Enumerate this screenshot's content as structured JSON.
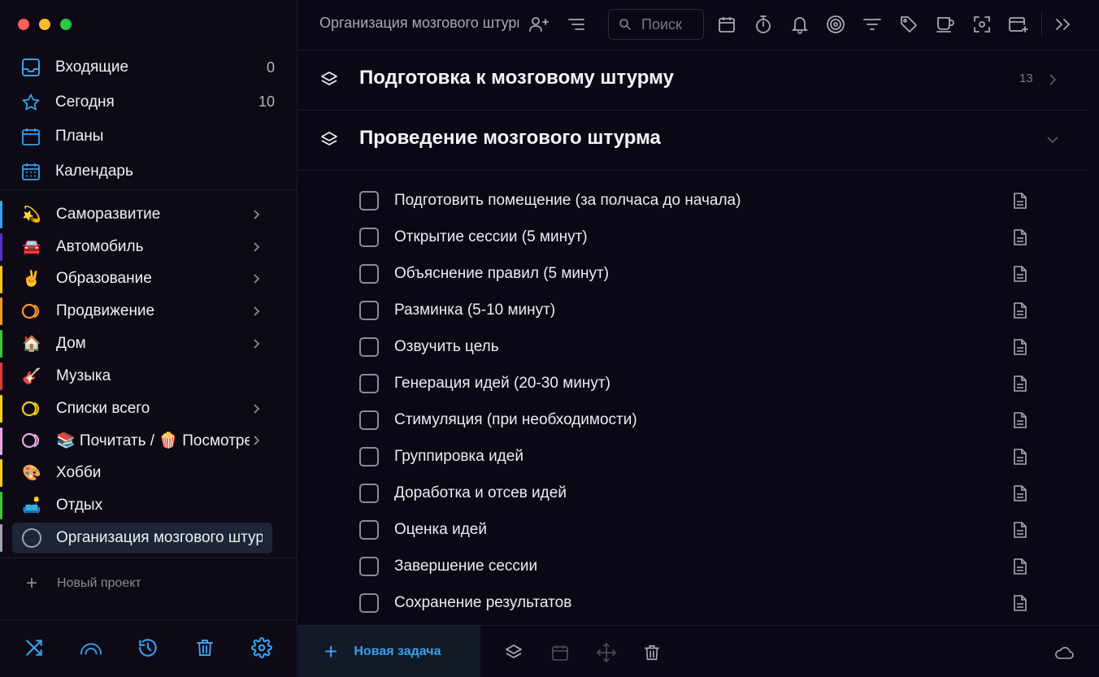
{
  "window": {
    "controls": [
      "close",
      "minimize",
      "maximize"
    ],
    "colors": [
      "#fe5f57",
      "#febc2e",
      "#28c840"
    ]
  },
  "nav": [
    {
      "label": "Входящие",
      "count": "0",
      "icon": "inbox-icon"
    },
    {
      "label": "Сегодня",
      "count": "10",
      "icon": "star-icon"
    },
    {
      "label": "Планы",
      "count": "",
      "icon": "calendar-12-icon",
      "icon_text": "12"
    },
    {
      "label": "Календарь",
      "count": "",
      "icon": "calendar-grid-icon"
    }
  ],
  "projects": [
    {
      "label": "Саморазвитие",
      "emoji": "💫",
      "color": "#3aa0e8",
      "has_children": true
    },
    {
      "label": "Автомобиль",
      "emoji": "🚘",
      "color": "#5b2fc9",
      "has_children": true
    },
    {
      "label": "Образование",
      "emoji": "✌️",
      "color": "#f5c518",
      "has_children": true
    },
    {
      "label": "Продвижение",
      "emoji": "",
      "color": "#f59b23",
      "has_children": true,
      "ring": "#f59b23"
    },
    {
      "label": "Дом",
      "emoji": "🏠",
      "color": "#3ec43a",
      "has_children": true
    },
    {
      "label": "Музыка",
      "emoji": "🎸",
      "color": "#e03a3a",
      "has_children": false
    },
    {
      "label": "Списки всего",
      "emoji": "",
      "color": "#f5d018",
      "has_children": true,
      "ring": "#f5d018"
    },
    {
      "label": "📚 Почитать / 🍿 Посмотреть",
      "emoji": "",
      "color": "#e9a6e6",
      "has_children": true,
      "ring": "#e9a6e6"
    },
    {
      "label": "Хобби",
      "emoji": "🎨",
      "color": "#f5d018",
      "has_children": false
    },
    {
      "label": "Отдых",
      "emoji": "🛋️",
      "color": "#3ec43a",
      "has_children": false
    },
    {
      "label": "Организация мозгового штурма",
      "emoji": "",
      "color": "#a3a3b0",
      "has_children": false,
      "active": true,
      "ring": "#a3a3b0"
    }
  ],
  "new_project_label": "Новый проект",
  "sidebar_bottom_icons": [
    "shuffle-icon",
    "arc-icon",
    "history-icon",
    "trash-icon",
    "settings-icon"
  ],
  "toolbar": {
    "title": "Организация мозгового штурма",
    "search_placeholder": "Поиск",
    "icons": [
      "add-person-icon",
      "sort-icon",
      "calendar-icon",
      "timer-icon",
      "bell-icon",
      "target-icon",
      "filter-icon",
      "tag-icon",
      "cup-icon",
      "focus-icon",
      "add-window-icon",
      "expand-icon"
    ]
  },
  "sections": [
    {
      "title": "Подготовка к мозговому штурму",
      "count": "13",
      "expanded": false
    },
    {
      "title": "Проведение мозгового штурма",
      "count": "",
      "expanded": true
    }
  ],
  "tasks": [
    "Подготовить помещение (за полчаса до начала)",
    "Открытие сессии (5 минут)",
    "Объяснение правил (5 минут)",
    "Разминка (5-10 минут)",
    "Озвучить цель",
    "Генерация идей (20-30 минут)",
    "Стимуляция (при необходимости)",
    "Группировка идей",
    "Доработка и отсев идей",
    "Оценка идей",
    "Завершение сессии",
    "Сохранение результатов"
  ],
  "bottom": {
    "new_task_label": "Новая задача",
    "icons": [
      "layers-icon",
      "calendar-icon",
      "move-icon",
      "trash-icon",
      "cloud-icon"
    ]
  },
  "colors": {
    "accent": "#3aa0e8",
    "background": "#0b0815",
    "active_project_bg": "#1d2537"
  }
}
